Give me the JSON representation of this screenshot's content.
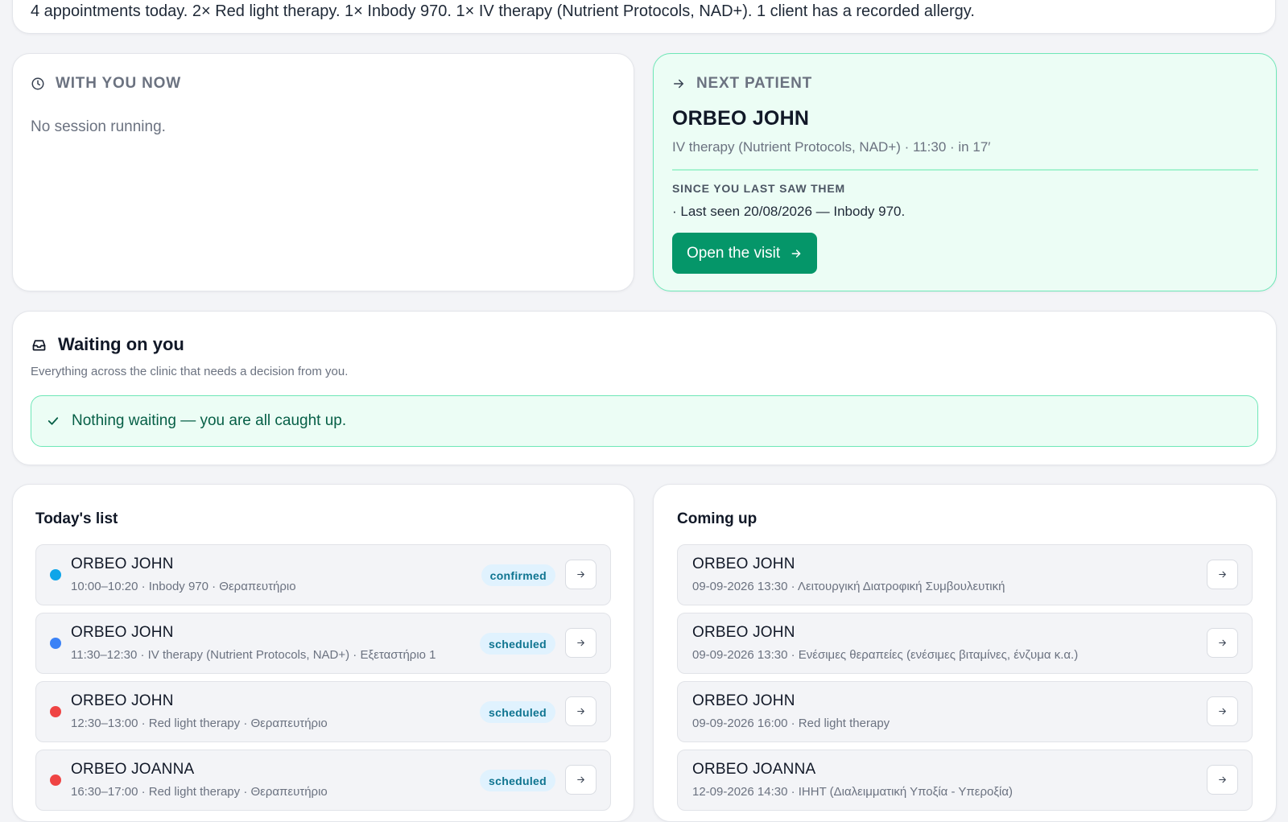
{
  "summary": {
    "text": "4 appointments today. 2× Red light therapy. 1× Inbody 970. 1× IV therapy (Nutrient Protocols, NAD+). 1 client has a recorded allergy."
  },
  "with_you_now": {
    "icon": "clock-icon",
    "title": "WITH YOU NOW",
    "empty_text": "No session running."
  },
  "next_patient": {
    "icon": "arrow-right-icon",
    "title": "NEXT PATIENT",
    "name": "ORBEO JOHN",
    "detail": "IV therapy (Nutrient Protocols, NAD+) · 11:30 · in 17′",
    "since_label": "SINCE YOU LAST SAW THEM",
    "since_item": "· Last seen 20/08/2026 — Inbody 970.",
    "button_label": "Open the visit"
  },
  "waiting": {
    "icon": "inbox-icon",
    "title": "Waiting on you",
    "subtitle": "Everything across the clinic that needs a decision from you.",
    "empty_icon": "check-icon",
    "empty_text": "Nothing waiting — you are all caught up."
  },
  "today": {
    "title": "Today's list",
    "items": [
      {
        "name": "ORBEO JOHN",
        "sub": "10:00–10:20 · Inbody 970 · Θεραπευτήριο",
        "status": "confirmed",
        "color": "#0ea5e9"
      },
      {
        "name": "ORBEO JOHN",
        "sub": "11:30–12:30 · IV therapy (Nutrient Protocols, NAD+) · Εξεταστήριο 1",
        "status": "scheduled",
        "color": "#3b82f6"
      },
      {
        "name": "ORBEO JOHN",
        "sub": "12:30–13:00 · Red light therapy · Θεραπευτήριο",
        "status": "scheduled",
        "color": "#ef4444"
      },
      {
        "name": "ORBEO JOANNA",
        "sub": "16:30–17:00 · Red light therapy · Θεραπευτήριο",
        "status": "scheduled",
        "color": "#ef4444"
      }
    ]
  },
  "coming_up": {
    "title": "Coming up",
    "items": [
      {
        "name": "ORBEO JOHN",
        "sub": "09-09-2026 13:30 · Λειτουργική Διατροφική Συμβουλευτική"
      },
      {
        "name": "ORBEO JOHN",
        "sub": "09-09-2026 13:30 · Ενέσιμες θεραπείες (ενέσιμες βιταμίνες, ένζυμα κ.α.)"
      },
      {
        "name": "ORBEO JOHN",
        "sub": "09-09-2026 16:00 · Red light therapy"
      },
      {
        "name": "ORBEO JOANNA",
        "sub": "12-09-2026 14:30 · IHHT (Διαλειμματική Υποξία - Υπεροξία)"
      }
    ]
  },
  "colors": {
    "accent": "#059669",
    "success_bg": "#ecfdf5",
    "success_border": "#6ee7b7"
  }
}
